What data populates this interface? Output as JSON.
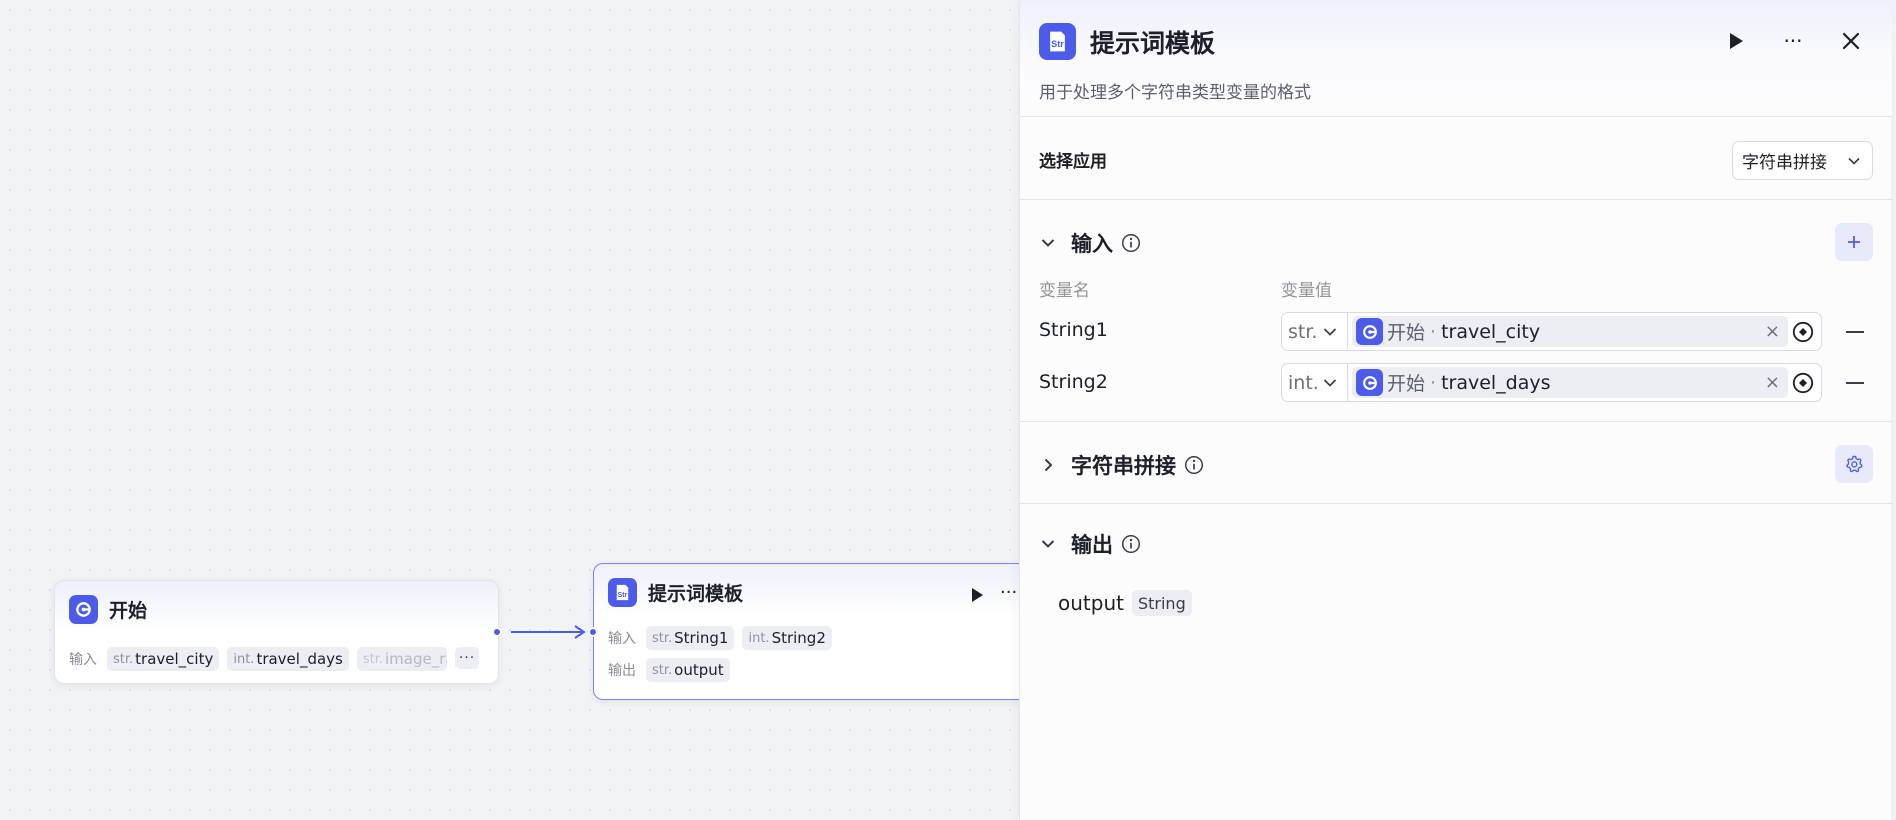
{
  "canvas": {
    "start_node": {
      "title": "开始",
      "input_label": "输入",
      "inputs": [
        {
          "type": "str.",
          "name": "travel_city"
        },
        {
          "type": "int.",
          "name": "travel_days"
        },
        {
          "type": "str.",
          "name": "image_ra"
        }
      ],
      "more": "···"
    },
    "template_node": {
      "icon_text": "Str",
      "title": "提示词模板",
      "input_label": "输入",
      "output_label": "输出",
      "inputs": [
        {
          "type": "str.",
          "name": "String1"
        },
        {
          "type": "int.",
          "name": "String2"
        }
      ],
      "outputs": [
        {
          "type": "str.",
          "name": "output"
        }
      ],
      "more": "···"
    }
  },
  "panel": {
    "icon_text": "Str",
    "title": "提示词模板",
    "description": "用于处理多个字符串类型变量的格式",
    "more": "···",
    "select_app": {
      "label": "选择应用",
      "value": "字符串拼接"
    },
    "inputs_section": {
      "title": "输入",
      "col_name": "变量名",
      "col_value": "变量值",
      "rows": [
        {
          "name": "String1",
          "type": "str.",
          "source": "开始",
          "separator": "·",
          "var": "travel_city",
          "clear": "×"
        },
        {
          "name": "String2",
          "type": "int.",
          "source": "开始",
          "separator": "·",
          "var": "travel_days",
          "clear": "×"
        }
      ]
    },
    "concat_section": {
      "title": "字符串拼接"
    },
    "output_section": {
      "title": "输出",
      "name": "output",
      "type": "String"
    }
  },
  "colors": {
    "accent": "#4c5ce9",
    "node_border_active": "#7d82f2",
    "button_tint": "#e8e9fa",
    "canvas_bg": "#f2f3f5"
  }
}
